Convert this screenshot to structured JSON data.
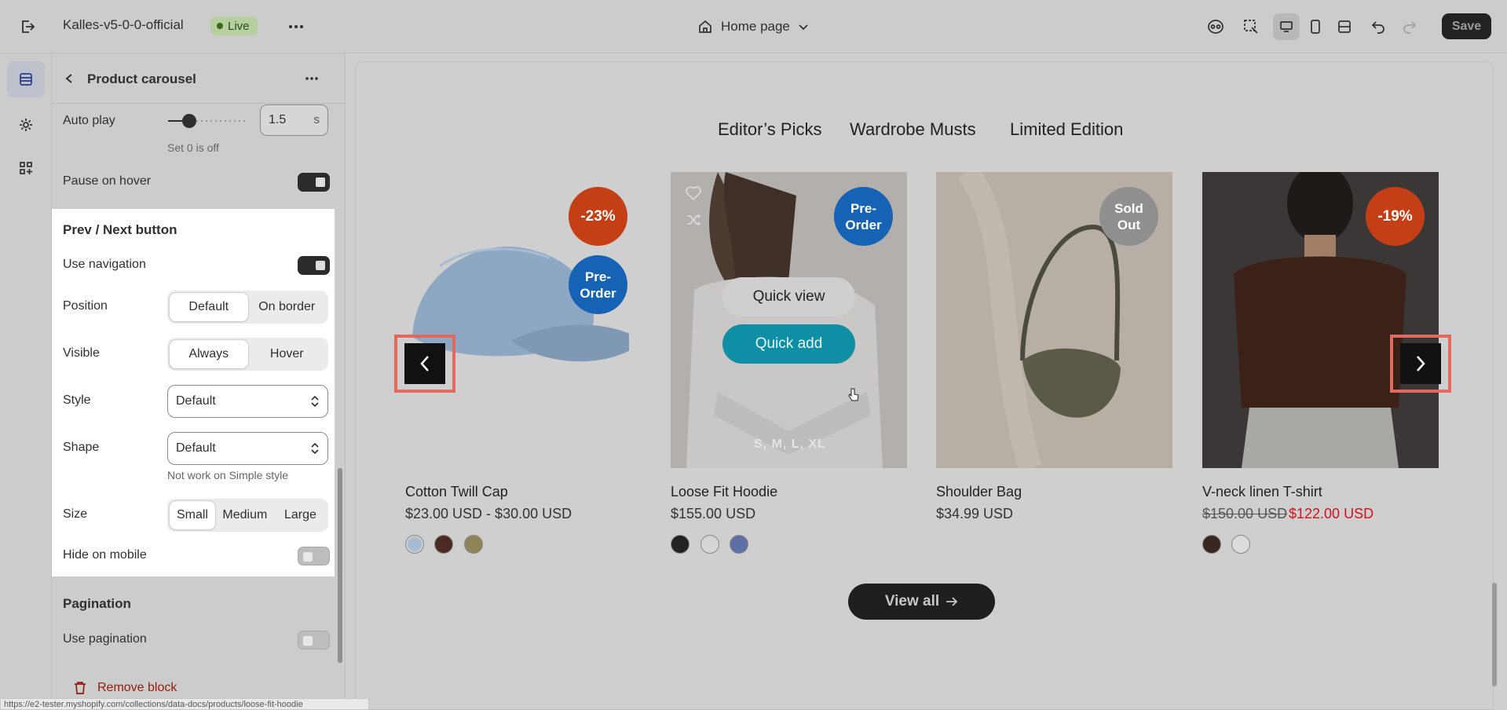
{
  "header": {
    "store_name": "Kalles-v5-0-0-official",
    "live_label": "Live",
    "page_label": "Home page",
    "save_label": "Save"
  },
  "sidebar": {
    "title": "Product carousel",
    "autoplay_label": "Auto play",
    "autoplay_value": "1.5",
    "autoplay_unit": "s",
    "autoplay_help": "Set 0 is off",
    "pause_label": "Pause on hover",
    "prev_next_heading": "Prev / Next button",
    "use_nav_label": "Use navigation",
    "position_label": "Position",
    "position_options": [
      "Default",
      "On border"
    ],
    "visible_label": "Visible",
    "visible_options": [
      "Always",
      "Hover"
    ],
    "style_label": "Style",
    "style_value": "Default",
    "shape_label": "Shape",
    "shape_value": "Default",
    "shape_help": "Not work on Simple style",
    "size_label": "Size",
    "size_options": [
      "Small",
      "Medium",
      "Large"
    ],
    "hide_mobile_label": "Hide on mobile",
    "pagination_heading": "Pagination",
    "use_pagination_label": "Use pagination",
    "remove_label": "Remove block"
  },
  "preview": {
    "tabs": [
      "Editor’s Picks",
      "Wardrobe Musts",
      "Limited Edition"
    ],
    "products": [
      {
        "name": "Cotton Twill Cap",
        "price": "$23.00 USD - $30.00 USD",
        "badges": [
          "-23%",
          "Pre-Order"
        ]
      },
      {
        "name": "Loose Fit Hoodie",
        "price": "$155.00 USD",
        "badges": [
          "Pre-Order"
        ],
        "sizes": "S, M, L, XL"
      },
      {
        "name": "Shoulder Bag",
        "price": "$34.99 USD",
        "badges": [
          "Sold Out"
        ]
      },
      {
        "name": "V-neck linen T-shirt",
        "old_price": "$150.00 USD",
        "sale_price": "$122.00 USD",
        "badges": [
          "-19%"
        ]
      }
    ],
    "quick_view": "Quick view",
    "quick_add": "Quick add",
    "view_all": "View all"
  },
  "status_url": "https://e2-tester.myshopify.com/collections/data-docs/products/loose-fit-hoodie",
  "colors": {
    "accent_red": "#c43f16",
    "accent_blue": "#1663b6",
    "teal": "#0e8fa6",
    "sale": "#d3121d"
  }
}
